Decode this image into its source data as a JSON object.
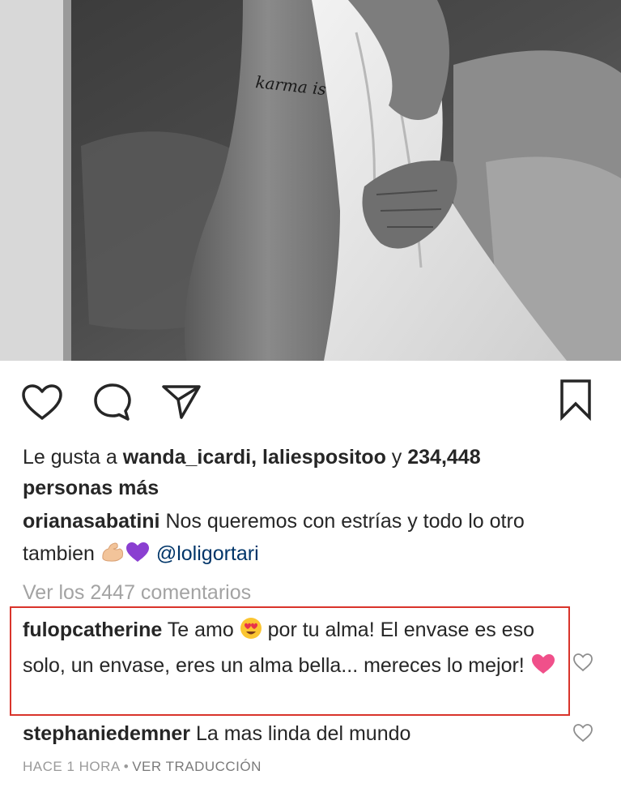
{
  "post": {
    "image_alt": "Black and white photo of a person holding a white sheet, side tattoo",
    "tattoo_text": "karma is"
  },
  "actions": {
    "like_icon": "heart-outline-icon",
    "comment_icon": "comment-bubble-icon",
    "share_icon": "paper-plane-icon",
    "save_icon": "bookmark-icon"
  },
  "likes": {
    "prefix": "Le gusta a ",
    "user1": "wanda_icardi",
    "separator": ", ",
    "user2": "laliespositoo",
    "connector": " y ",
    "count": "234,448",
    "suffix": "personas más"
  },
  "caption": {
    "username": "orianasabatini",
    "text": " Nos queremos con estrías y todo lo otro tambien ",
    "mention": "@loligortari"
  },
  "view_comments": "Ver los 2447 comentarios",
  "comments": [
    {
      "username": "fulopcatherine",
      "text_before_emoji": " Te amo ",
      "text_after_emoji": " por tu alma! El envase es eso solo, un envase, eres un alma bella... mereces lo mejor! "
    },
    {
      "username": "stephaniedemner",
      "text": " La mas linda del mundo"
    }
  ],
  "meta": {
    "time": "HACE 1 HORA",
    "separator": "•",
    "translate": "VER TRADUCCIÓN"
  },
  "colors": {
    "highlight": "#d9342b",
    "mention": "#003569",
    "muted": "#a3a3a3",
    "heart_emoji": "#f0508a",
    "purple_heart": "#8a3fd1"
  }
}
